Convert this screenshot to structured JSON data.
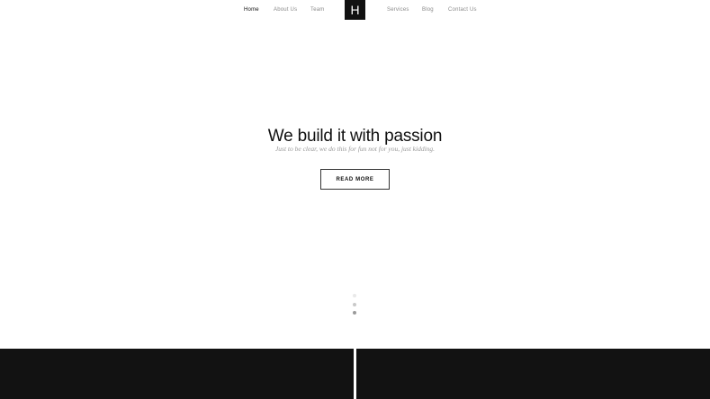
{
  "nav": {
    "left": [
      {
        "label": "Home",
        "active": true
      },
      {
        "label": "About Us",
        "active": false
      },
      {
        "label": "Team",
        "active": false
      }
    ],
    "logo": "H",
    "right": [
      {
        "label": "Services",
        "active": false
      },
      {
        "label": "Blog",
        "active": false
      },
      {
        "label": "Contact Us",
        "active": false
      }
    ]
  },
  "hero": {
    "title": "We build it with passion",
    "subtitle": "Just to be clear, we do this for fun not for you, just kidding.",
    "button_label": "READ MORE"
  },
  "slider": {
    "slide_count": 3,
    "active_index": 2
  },
  "colors": {
    "text": "#111111",
    "muted": "#8a8a8a",
    "dark_panel": "#121212",
    "background": "#ffffff"
  }
}
